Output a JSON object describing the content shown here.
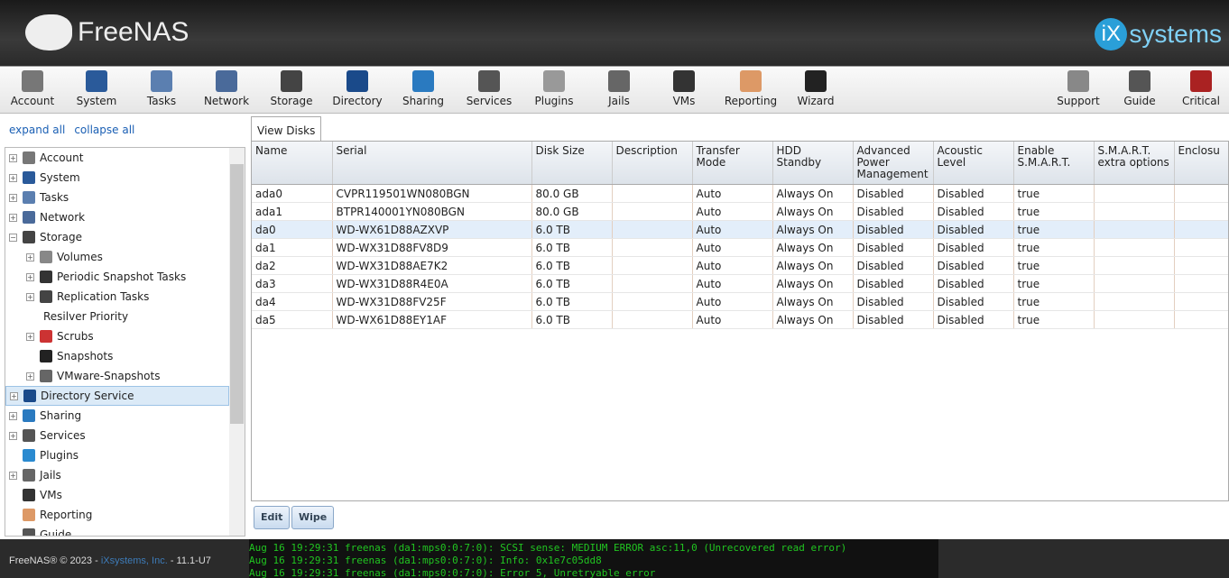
{
  "header": {
    "logo": "FreeNAS",
    "brand_badge": "iX",
    "brand": "systems"
  },
  "toolbar": [
    {
      "label": "Account",
      "c": "#777"
    },
    {
      "label": "System",
      "c": "#2a5a9a"
    },
    {
      "label": "Tasks",
      "c": "#5b7fb0"
    },
    {
      "label": "Network",
      "c": "#4a6a9a"
    },
    {
      "label": "Storage",
      "c": "#444"
    },
    {
      "label": "Directory",
      "c": "#1a4a8a"
    },
    {
      "label": "Sharing",
      "c": "#2a7ac0"
    },
    {
      "label": "Services",
      "c": "#555"
    },
    {
      "label": "Plugins",
      "c": "#999"
    },
    {
      "label": "Jails",
      "c": "#666"
    },
    {
      "label": "VMs",
      "c": "#333"
    },
    {
      "label": "Reporting",
      "c": "#d96"
    },
    {
      "label": "Wizard",
      "c": "#222"
    }
  ],
  "toolbar_right": [
    {
      "label": "Support",
      "c": "#888"
    },
    {
      "label": "Guide",
      "c": "#555"
    },
    {
      "label": "Critical",
      "c": "#a22"
    }
  ],
  "sidebar": {
    "expand_all": "expand all",
    "collapse_all": "collapse all",
    "items": [
      {
        "label": "Account",
        "pm": "+",
        "lvl": 0,
        "c": "#777"
      },
      {
        "label": "System",
        "pm": "+",
        "lvl": 0,
        "c": "#2a5a9a"
      },
      {
        "label": "Tasks",
        "pm": "+",
        "lvl": 0,
        "c": "#5b7fb0"
      },
      {
        "label": "Network",
        "pm": "+",
        "lvl": 0,
        "c": "#4a6a9a"
      },
      {
        "label": "Storage",
        "pm": "−",
        "lvl": 0,
        "c": "#444"
      },
      {
        "label": "Volumes",
        "pm": "+",
        "lvl": 1,
        "c": "#888"
      },
      {
        "label": "Periodic Snapshot Tasks",
        "pm": "+",
        "lvl": 1,
        "c": "#333"
      },
      {
        "label": "Replication Tasks",
        "pm": "+",
        "lvl": 1,
        "c": "#444"
      },
      {
        "label": "Resilver Priority",
        "pm": "",
        "lvl": 1,
        "c": ""
      },
      {
        "label": "Scrubs",
        "pm": "+",
        "lvl": 1,
        "c": "#c33"
      },
      {
        "label": "Snapshots",
        "pm": "",
        "lvl": 1,
        "c": "#222"
      },
      {
        "label": "VMware-Snapshots",
        "pm": "+",
        "lvl": 1,
        "c": "#666"
      },
      {
        "label": "Directory Service",
        "pm": "+",
        "lvl": 0,
        "c": "#1a4a8a",
        "sel": true
      },
      {
        "label": "Sharing",
        "pm": "+",
        "lvl": 0,
        "c": "#2a7ac0"
      },
      {
        "label": "Services",
        "pm": "+",
        "lvl": 0,
        "c": "#555"
      },
      {
        "label": "Plugins",
        "pm": "",
        "lvl": 0,
        "c": "#2a8ad0"
      },
      {
        "label": "Jails",
        "pm": "+",
        "lvl": 0,
        "c": "#666"
      },
      {
        "label": "VMs",
        "pm": "",
        "lvl": 0,
        "c": "#333"
      },
      {
        "label": "Reporting",
        "pm": "",
        "lvl": 0,
        "c": "#d96"
      },
      {
        "label": "Guide",
        "pm": "",
        "lvl": 0,
        "c": "#555"
      }
    ]
  },
  "main": {
    "tab": "View Disks",
    "columns": [
      "Name",
      "Serial",
      "Disk Size",
      "Description",
      "Transfer Mode",
      "HDD Standby",
      "Advanced Power Management",
      "Acoustic Level",
      "Enable S.M.A.R.T.",
      "S.M.A.R.T. extra options",
      "Enclosu"
    ],
    "rows": [
      [
        "ada0",
        "CVPR119501WN080BGN",
        "80.0 GB",
        "",
        "Auto",
        "Always On",
        "Disabled",
        "Disabled",
        "true",
        "",
        ""
      ],
      [
        "ada1",
        "BTPR140001YN080BGN",
        "80.0 GB",
        "",
        "Auto",
        "Always On",
        "Disabled",
        "Disabled",
        "true",
        "",
        ""
      ],
      [
        "da0",
        "WD-WX61D88AZXVP",
        "6.0 TB",
        "",
        "Auto",
        "Always On",
        "Disabled",
        "Disabled",
        "true",
        "",
        ""
      ],
      [
        "da1",
        "WD-WX31D88FV8D9",
        "6.0 TB",
        "",
        "Auto",
        "Always On",
        "Disabled",
        "Disabled",
        "true",
        "",
        ""
      ],
      [
        "da2",
        "WD-WX31D88AE7K2",
        "6.0 TB",
        "",
        "Auto",
        "Always On",
        "Disabled",
        "Disabled",
        "true",
        "",
        ""
      ],
      [
        "da3",
        "WD-WX31D88R4E0A",
        "6.0 TB",
        "",
        "Auto",
        "Always On",
        "Disabled",
        "Disabled",
        "true",
        "",
        ""
      ],
      [
        "da4",
        "WD-WX31D88FV25F",
        "6.0 TB",
        "",
        "Auto",
        "Always On",
        "Disabled",
        "Disabled",
        "true",
        "",
        ""
      ],
      [
        "da5",
        "WD-WX61D88EY1AF",
        "6.0 TB",
        "",
        "Auto",
        "Always On",
        "Disabled",
        "Disabled",
        "true",
        "",
        ""
      ]
    ],
    "selected_row": 2,
    "edit": "Edit",
    "wipe": "Wipe"
  },
  "footer": {
    "copy": "FreeNAS® © 2023 - ",
    "company": "iXsystems, Inc.",
    "version": " - 11.1-U7",
    "log": [
      "Aug 16 19:29:31 freenas (da1:mps0:0:7:0): SCSI sense: MEDIUM ERROR asc:11,0 (Unrecovered read error)",
      "Aug 16 19:29:31 freenas (da1:mps0:0:7:0): Info: 0x1e7c05dd8",
      "Aug 16 19:29:31 freenas (da1:mps0:0:7:0): Error 5, Unretryable error"
    ]
  }
}
